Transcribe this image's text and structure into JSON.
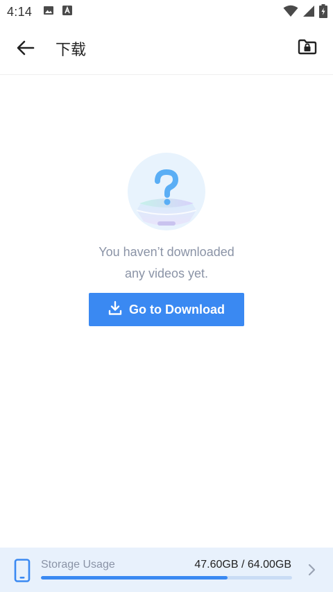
{
  "status_bar": {
    "time": "4:14",
    "left_icons": [
      "image-icon",
      "app-a-icon"
    ],
    "right_icons": [
      "wifi-icon",
      "signal-icon",
      "battery-charging-icon"
    ]
  },
  "app_bar": {
    "title": "下载",
    "back_icon": "arrow-left-icon",
    "action_icon": "lock-folder-icon"
  },
  "empty_state": {
    "illustration": "question-box-illustration",
    "line1": "You haven’t downloaded",
    "line2": "any videos yet.",
    "button_label": "Go to Download",
    "button_icon": "download-icon"
  },
  "storage": {
    "label": "Storage Usage",
    "value": "47.60GB / 64.00GB",
    "used_gb": 47.6,
    "total_gb": 64.0,
    "icon": "phone-icon",
    "chevron": "chevron-right-icon"
  },
  "colors": {
    "accent": "#3a89f2",
    "storage_bg": "#e8f1fc",
    "muted_text": "#8a93a6"
  }
}
